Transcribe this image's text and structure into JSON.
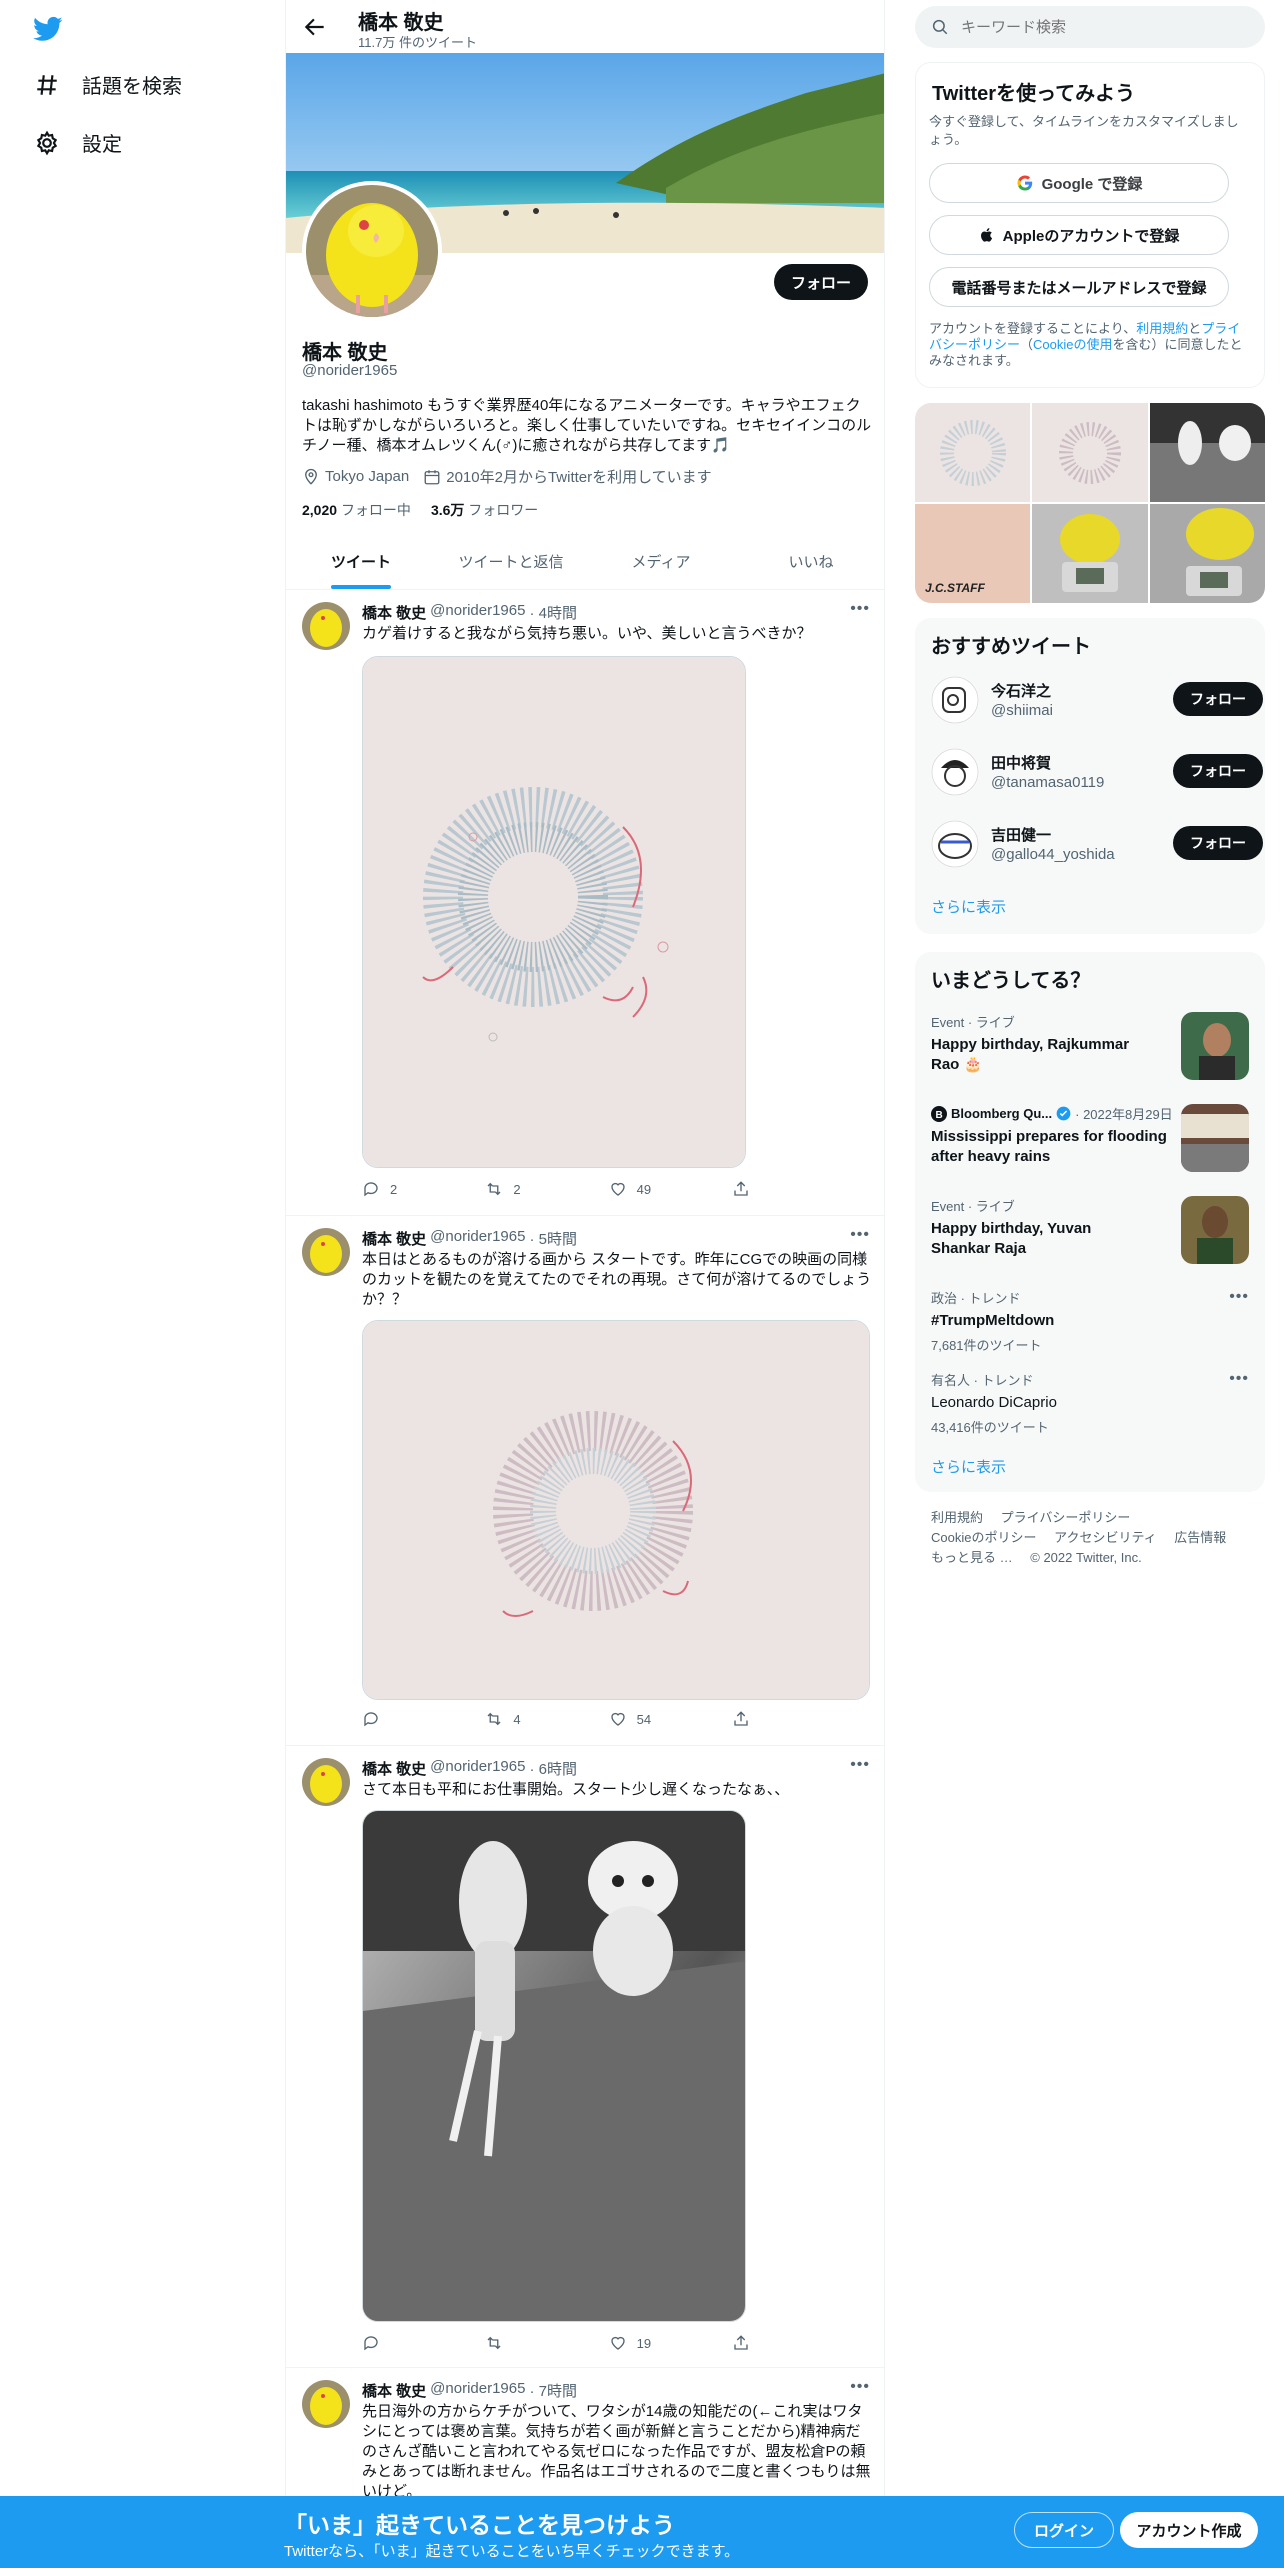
{
  "nav": {
    "logo_icon": "twitter-bird-icon",
    "items": [
      {
        "label": "話題を検索",
        "icon": "hashtag-icon"
      },
      {
        "label": "設定",
        "icon": "gear-icon"
      }
    ]
  },
  "header": {
    "name": "橋本 敬史",
    "tweet_count": "11.7万 件のツイート"
  },
  "profile": {
    "name": "橋本 敬史",
    "handle": "@norider1965",
    "bio": "takashi hashimoto もうすぐ業界歴40年になるアニメーターです。キャラやエフェクトは恥ずかしながらいろいろと。楽しく仕事していたいですね。セキセイインコのルチノー種、橋本オムレツくん(♂)に癒されながら共存してます🎵",
    "location": "Tokyo Japan",
    "joined": "2010年2月からTwitterを利用しています",
    "following_count": "2,020",
    "following_label": "フォロー中",
    "followers_count": "3.6万",
    "followers_label": "フォロワー",
    "follow_label": "フォロー"
  },
  "tabs": [
    "ツイート",
    "ツイートと返信",
    "メディア",
    "いいね"
  ],
  "tweets": [
    {
      "name": "橋本 敬史",
      "handle": "@norider1965",
      "time": "· 4時間",
      "text": "カゲ着けすると我ながら気持ち悪い。いや、美しいと言うべきか？",
      "replies": "2",
      "retweets": "2",
      "likes": "49"
    },
    {
      "name": "橋本 敬史",
      "handle": "@norider1965",
      "time": "· 5時間",
      "text": "本日はとあるものが溶ける画から スタートです。昨年にCGでの映画の同様のカットを観たのを覚えてたのでそれの再現。さて何が溶けてるのでしょうか？？",
      "replies": "",
      "retweets": "4",
      "likes": "54"
    },
    {
      "name": "橋本 敬史",
      "handle": "@norider1965",
      "time": "· 6時間",
      "text": "さて本日も平和にお仕事開始。スタート少し遅くなったなぁ、、",
      "replies": "",
      "retweets": "",
      "likes": "19"
    },
    {
      "name": "橋本 敬史",
      "handle": "@norider1965",
      "time": "· 7時間",
      "text": "先日海外の方からケチがついて、ワタシが14歳の知能だの(←これ実はワタシにとっては褒め言葉。気持ちが若く画が新鮮と言うことだから)精神病だのさんざ酷いこと言われてやる気ゼロになった作品ですが、盟友松倉Pの頼みとあっては断れません。作品名はエゴサされるので二度と書くつもりは無いけど。"
    }
  ],
  "right": {
    "search_placeholder": "キーワード検索",
    "signup": {
      "title": "Twitterを使ってみよう",
      "subtitle": "今すぐ登録して、タイムラインをカスタマイズしましょう。",
      "google": "Google で登録",
      "apple": "Appleのアカウントで登録",
      "phone": "電話番号またはメールアドレスで登録",
      "terms_a": "アカウントを登録することにより、",
      "terms_link1": "利用規約",
      "terms_b": "と",
      "terms_link2": "プライバシーポリシー",
      "terms_c": "（",
      "terms_link3": "Cookieの使用",
      "terms_d": "を含む）に同意したとみなされます。"
    },
    "recommended": {
      "title": "おすすめツイート",
      "users": [
        {
          "name": "今石洋之",
          "handle": "@shiimai"
        },
        {
          "name": "田中将賀",
          "handle": "@tanamasa0119"
        },
        {
          "name": "吉田健一",
          "handle": "@gallo44_yoshida"
        }
      ],
      "follow_label": "フォロー",
      "more": "さらに表示"
    },
    "trends": {
      "title": "いまどうしてる？",
      "items": [
        {
          "meta": "Event · ライブ",
          "title": "Happy birthday, Rajkummar Rao 🎂"
        },
        {
          "meta_source": "Bloomberg Qu...",
          "meta_date": "· 2022年8月29日",
          "title": "Mississippi prepares for flooding after heavy rains"
        },
        {
          "meta": "Event · ライブ",
          "title": "Happy birthday, Yuvan Shankar Raja"
        },
        {
          "meta": "政治 · トレンド",
          "title": "#TrumpMeltdown",
          "count": "7,681件のツイート"
        },
        {
          "meta": "有名人 · トレンド",
          "title": "Leonardo DiCaprio",
          "count": "43,416件のツイート"
        }
      ],
      "more": "さらに表示"
    },
    "footer": {
      "links": [
        "利用規約",
        "プライバシーポリシー",
        "Cookieのポリシー",
        "アクセシビリティ",
        "広告情報",
        "もっと見る …"
      ],
      "copyright": "© 2022 Twitter, Inc."
    }
  },
  "bottom_bar": {
    "title": "「いま」起きていることを見つけよう",
    "subtitle": "Twitterなら、「いま」起きていることをいち早くチェックできます。",
    "login": "ログイン",
    "signup": "アカウント作成"
  },
  "colors": {
    "accent": "#1d9bf0",
    "text": "#0f1419",
    "muted": "#536471"
  }
}
